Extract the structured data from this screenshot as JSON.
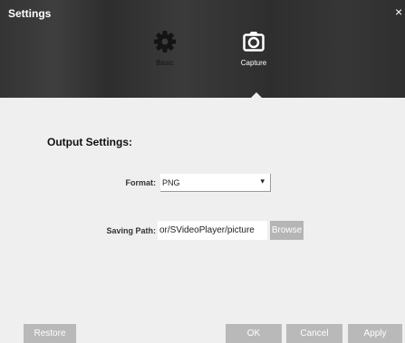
{
  "window": {
    "title": "Settings",
    "close_label": "×"
  },
  "tabs": [
    {
      "label": "Basic",
      "icon": "gear-icon",
      "active": false
    },
    {
      "label": "Capture",
      "icon": "camera-icon",
      "active": true
    }
  ],
  "section": {
    "title": "Output Settings:"
  },
  "format": {
    "label": "Format:",
    "value": "PNG",
    "arrow": "▾"
  },
  "saving_path": {
    "label": "Saving Path:",
    "value": "or/SVideoPlayer/picture",
    "browse_label": "Browse"
  },
  "buttons": {
    "restore": "Restore",
    "ok": "OK",
    "cancel": "Cancel",
    "apply": "Apply"
  },
  "colors": {
    "header": "#303030",
    "background": "#efefef",
    "button": "#b9b9b9"
  }
}
